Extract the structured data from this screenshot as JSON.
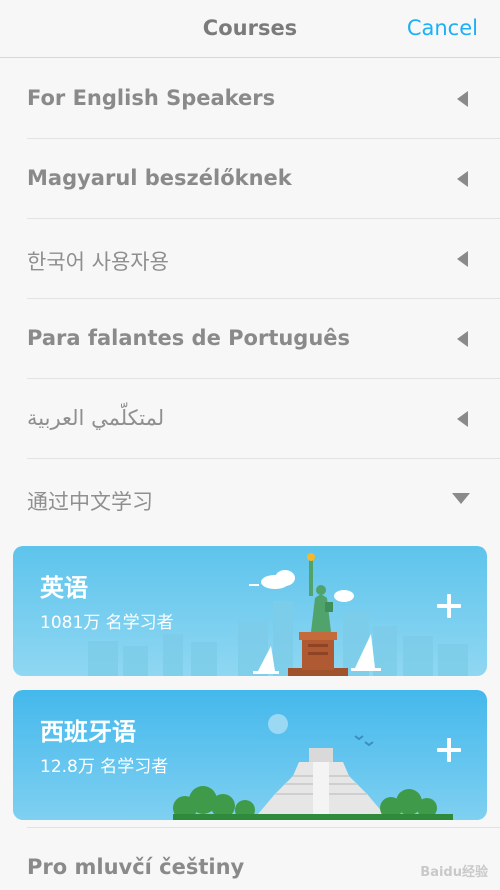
{
  "navbar": {
    "title": "Courses",
    "cancel_label": "Cancel"
  },
  "rows": [
    {
      "label": "For English Speakers",
      "state": "collapsed"
    },
    {
      "label": "Magyarul beszélőknek",
      "state": "collapsed"
    },
    {
      "label": "한국어 사용자용",
      "state": "collapsed"
    },
    {
      "label": "Para falantes de Português",
      "state": "collapsed"
    },
    {
      "label": "لمتكلّمي العربية",
      "state": "collapsed"
    },
    {
      "label": "通过中文学习",
      "state": "expanded"
    }
  ],
  "courses": [
    {
      "title": "英语",
      "learners": "1081万 名学习者",
      "icon": "statue-of-liberty-illustration"
    },
    {
      "title": "西班牙语",
      "learners": "12.8万 名学习者",
      "icon": "mayan-pyramid-illustration"
    }
  ],
  "bottom_row": {
    "label": "Pro mluvčí češtiny"
  },
  "watermark": "Baidu经验",
  "colors": {
    "accent": "#1cb0f6",
    "text": "#8a8a8a",
    "card": "#5ec4ec"
  }
}
